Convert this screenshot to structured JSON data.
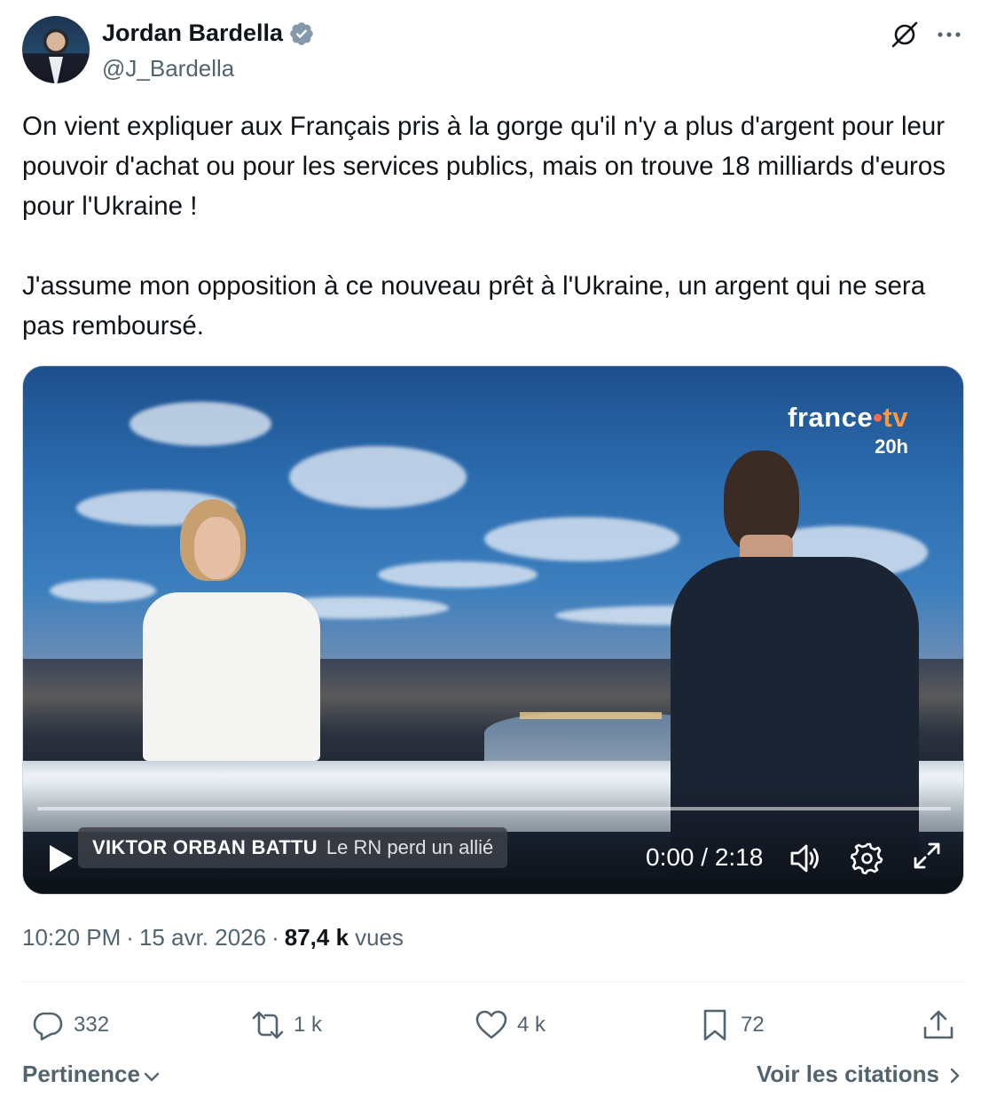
{
  "author": {
    "name": "Jordan Bardella",
    "handle": "@J_Bardella",
    "verified_color": "#829aab"
  },
  "tweet": {
    "paragraphs": [
      "On vient expliquer aux Français pris à la gorge qu'il n'y a plus d'argent pour leur pouvoir d'achat ou pour les services publics, mais on trouve 18 milliards d'euros pour l'Ukraine !",
      "J'assume mon opposition à ce nouveau prêt à l'Ukraine, un argent qui ne sera pas remboursé."
    ]
  },
  "video": {
    "channel_brand_prefix": "france",
    "channel_brand_dot": "•",
    "channel_brand_suffix": "tv",
    "channel_slot": "20h",
    "banner_bold": "VIKTOR ORBAN BATTU",
    "banner_light": "Le RN perd un allié",
    "time": "0:00 / 2:18",
    "progress": 0,
    "icons": [
      "play-icon",
      "volume-icon",
      "settings-icon",
      "fullscreen-icon"
    ]
  },
  "meta": {
    "time": "10:20 PM",
    "separator": "·",
    "date": "15 avr. 2026",
    "views_count": "87,4 k",
    "views_label": "vues"
  },
  "actions": {
    "replies": "332",
    "reposts": "1 k",
    "likes": "4 k",
    "bookmarks": "72"
  },
  "footer": {
    "sort_label": "Pertinence",
    "quotes_label": "Voir les citations"
  },
  "colors": {
    "text_primary": "#0f1419",
    "text_secondary": "#536471",
    "divider": "#eff3f4"
  }
}
